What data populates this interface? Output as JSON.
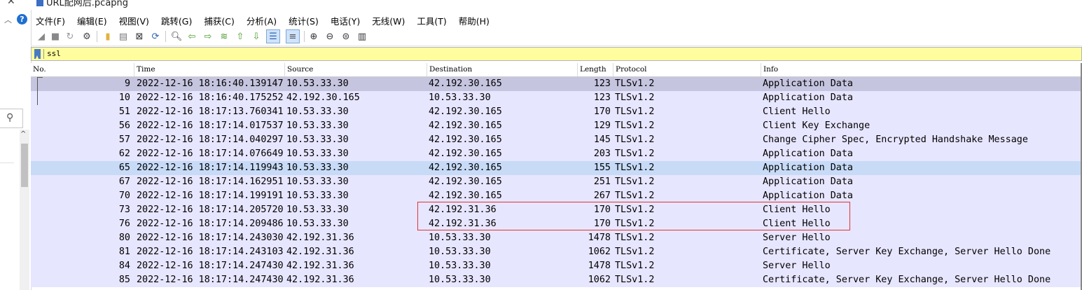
{
  "titlebar": {
    "title": "URL配网后.pcapng"
  },
  "menu": {
    "items": [
      "文件(F)",
      "编辑(E)",
      "视图(V)",
      "跳转(G)",
      "捕获(C)",
      "分析(A)",
      "统计(S)",
      "电话(Y)",
      "无线(W)",
      "工具(T)",
      "帮助(H)"
    ]
  },
  "toolbar": {
    "icons": [
      "shark-fin-start-icon",
      "stop-icon",
      "restart-icon",
      "options-gear-icon",
      "open-folder-icon",
      "save-file-icon",
      "close-file-icon",
      "reload-icon",
      "find-icon",
      "back-arrow-icon",
      "forward-arrow-icon",
      "goto-packet-icon",
      "first-packet-icon",
      "last-packet-icon",
      "autoscroll-icon",
      "colorize-icon",
      "zoom-in-icon",
      "zoom-out-icon",
      "zoom-normal-icon",
      "resize-columns-icon"
    ]
  },
  "filter": {
    "value": "ssl"
  },
  "columns": {
    "no": "No.",
    "time": "Time",
    "source": "Source",
    "destination": "Destination",
    "length": "Length",
    "protocol": "Protocol",
    "info": "Info"
  },
  "packets": [
    {
      "no": "9",
      "time": "2022-12-16 18:16:40.139147",
      "src": "10.53.33.30",
      "dst": "42.192.30.165",
      "len": "123",
      "proto": "TLSv1.2",
      "info": "Application Data"
    },
    {
      "no": "10",
      "time": "2022-12-16 18:16:40.175252",
      "src": "42.192.30.165",
      "dst": "10.53.33.30",
      "len": "123",
      "proto": "TLSv1.2",
      "info": "Application Data"
    },
    {
      "no": "51",
      "time": "2022-12-16 18:17:13.760341",
      "src": "10.53.33.30",
      "dst": "42.192.30.165",
      "len": "170",
      "proto": "TLSv1.2",
      "info": "Client Hello"
    },
    {
      "no": "56",
      "time": "2022-12-16 18:17:14.017537",
      "src": "10.53.33.30",
      "dst": "42.192.30.165",
      "len": "129",
      "proto": "TLSv1.2",
      "info": "Client Key Exchange"
    },
    {
      "no": "57",
      "time": "2022-12-16 18:17:14.040297",
      "src": "10.53.33.30",
      "dst": "42.192.30.165",
      "len": "145",
      "proto": "TLSv1.2",
      "info": "Change Cipher Spec, Encrypted Handshake Message"
    },
    {
      "no": "62",
      "time": "2022-12-16 18:17:14.076649",
      "src": "10.53.33.30",
      "dst": "42.192.30.165",
      "len": "203",
      "proto": "TLSv1.2",
      "info": "Application Data"
    },
    {
      "no": "65",
      "time": "2022-12-16 18:17:14.119943",
      "src": "10.53.33.30",
      "dst": "42.192.30.165",
      "len": "155",
      "proto": "TLSv1.2",
      "info": "Application Data"
    },
    {
      "no": "67",
      "time": "2022-12-16 18:17:14.162951",
      "src": "10.53.33.30",
      "dst": "42.192.30.165",
      "len": "251",
      "proto": "TLSv1.2",
      "info": "Application Data"
    },
    {
      "no": "70",
      "time": "2022-12-16 18:17:14.199191",
      "src": "10.53.33.30",
      "dst": "42.192.30.165",
      "len": "267",
      "proto": "TLSv1.2",
      "info": "Application Data"
    },
    {
      "no": "73",
      "time": "2022-12-16 18:17:14.205720",
      "src": "10.53.33.30",
      "dst": "42.192.31.36",
      "len": "170",
      "proto": "TLSv1.2",
      "info": "Client Hello"
    },
    {
      "no": "76",
      "time": "2022-12-16 18:17:14.209486",
      "src": "10.53.33.30",
      "dst": "42.192.31.36",
      "len": "170",
      "proto": "TLSv1.2",
      "info": "Client Hello"
    },
    {
      "no": "80",
      "time": "2022-12-16 18:17:14.243030",
      "src": "42.192.31.36",
      "dst": "10.53.33.30",
      "len": "1478",
      "proto": "TLSv1.2",
      "info": "Server Hello"
    },
    {
      "no": "81",
      "time": "2022-12-16 18:17:14.243103",
      "src": "42.192.31.36",
      "dst": "10.53.33.30",
      "len": "1062",
      "proto": "TLSv1.2",
      "info": "Certificate, Server Key Exchange, Server Hello Done"
    },
    {
      "no": "84",
      "time": "2022-12-16 18:17:14.247430",
      "src": "42.192.31.36",
      "dst": "10.53.33.30",
      "len": "1478",
      "proto": "TLSv1.2",
      "info": "Server Hello"
    },
    {
      "no": "85",
      "time": "2022-12-16 18:17:14.247430",
      "src": "42.192.31.36",
      "dst": "10.53.33.30",
      "len": "1062",
      "proto": "TLSv1.2",
      "info": "Certificate, Server Key Exchange, Server Hello Done"
    }
  ],
  "colors": {
    "row_bg": "#e7e6ff",
    "row_selected": "#c6c5e0",
    "row_hover": "#c7dbf7",
    "filter_bg": "#fffd9e",
    "annotation_box": "#e0323c"
  }
}
